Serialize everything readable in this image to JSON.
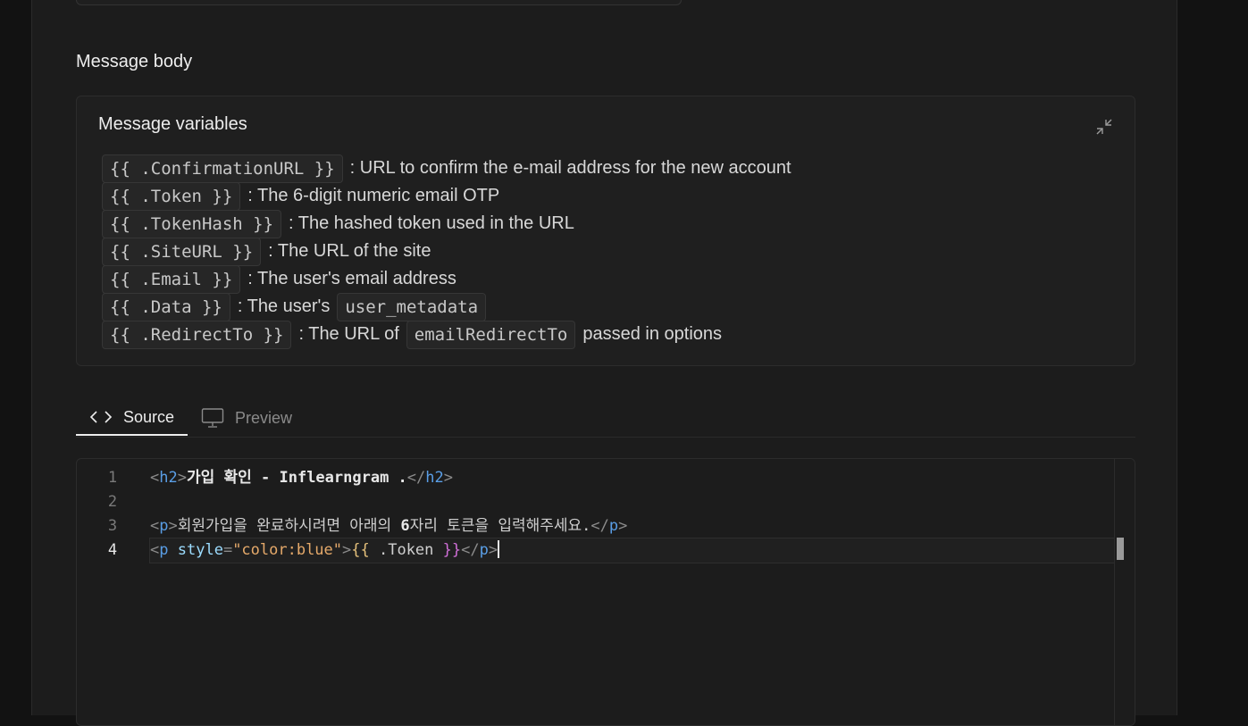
{
  "section": {
    "title": "Message body"
  },
  "variables": {
    "title": "Message variables",
    "rows": [
      {
        "code": "{{ .ConfirmationURL }}",
        "text": ": URL to confirm the e-mail address for the new account"
      },
      {
        "code": "{{ .Token }}",
        "text": ": The 6-digit numeric email OTP"
      },
      {
        "code": "{{ .TokenHash }}",
        "text": ": The hashed token used in the URL"
      },
      {
        "code": "{{ .SiteURL }}",
        "text": ": The URL of the site"
      },
      {
        "code": "{{ .Email }}",
        "text": ": The user's email address"
      },
      {
        "code": "{{ .Data }}",
        "text": ": The user's",
        "code2": "user_metadata"
      },
      {
        "code": "{{ .RedirectTo }}",
        "text": ": The URL of",
        "code2": "emailRedirectTo",
        "text2": "passed in options"
      }
    ]
  },
  "tabs": {
    "source": "Source",
    "preview": "Preview"
  },
  "editor": {
    "line_numbers": [
      "1",
      "2",
      "3",
      "4"
    ],
    "line1": {
      "open_tag": "h2",
      "text": "가입 확인 - Inflearngram .",
      "close_tag": "h2"
    },
    "line3": {
      "open_tag": "p",
      "text_a": "회원가입을 완료하시려면 아래의 ",
      "bold": "6",
      "text_b": "자리 토큰을 입력해주세요.",
      "close_tag": "p"
    },
    "line4": {
      "open_tag": "p",
      "attr": "style",
      "value": "\"color:blue\"",
      "expr_open": "{{",
      "expr_body": " .Token ",
      "expr_close": "}}",
      "close_tag": "p"
    }
  }
}
